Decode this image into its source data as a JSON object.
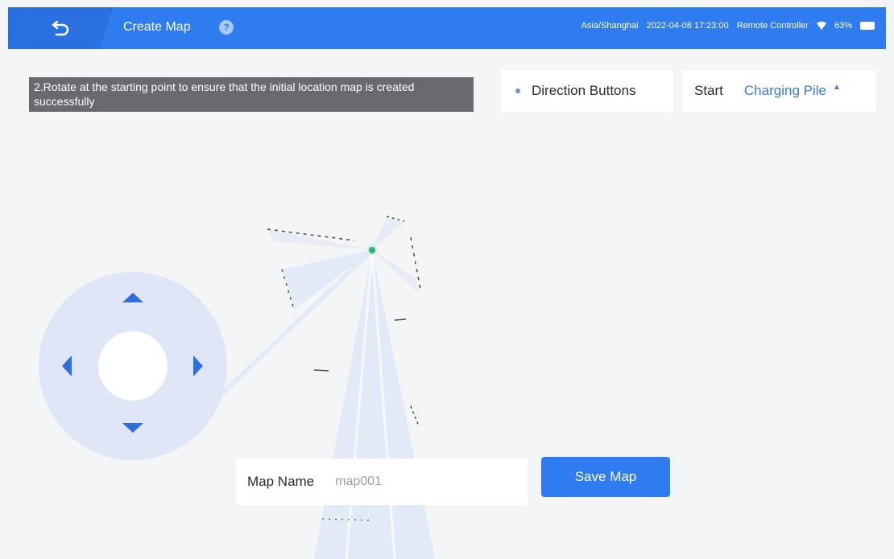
{
  "header": {
    "title": "Create Map",
    "help_icon": "question-icon",
    "back_icon": "back-icon",
    "timezone": "Asia/Shanghai",
    "datetime": "2022-04-08 17:23:00",
    "controller": "Remote Controller",
    "battery": "63%"
  },
  "hint": {
    "text": "2.Rotate at the starting point to ensure that the initial location map is created successfully"
  },
  "controls": {
    "direction_label": "Direction Buttons",
    "start_label": "Start",
    "start_value": "Charging Pile"
  },
  "map_name": {
    "label": "Map Name",
    "value": "map001"
  },
  "actions": {
    "save_label": "Save Map"
  },
  "colors": {
    "accent": "#2f7bf0",
    "robot": "#2fb37a",
    "scan_fill": "#dfe7f7"
  }
}
